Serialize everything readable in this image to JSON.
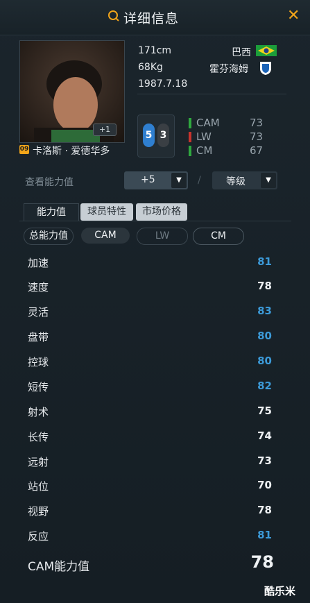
{
  "header": {
    "title": "详细信息",
    "close_symbol": "✕"
  },
  "player": {
    "name": "卡洛斯 · 爱德华多",
    "overall_badge": "09",
    "portrait_badge": "+1",
    "height": "171cm",
    "weight": "68Kg",
    "birth": "1987.7.18",
    "nationality": "巴西",
    "club": "霍芬海姆"
  },
  "feet": {
    "left": "5",
    "right": "3"
  },
  "positions": [
    {
      "pos": "CAM",
      "rating": "73",
      "color": "#2fa83f"
    },
    {
      "pos": "LW",
      "rating": "73",
      "color": "#c8342d"
    },
    {
      "pos": "CM",
      "rating": "67",
      "color": "#2fa83f"
    }
  ],
  "controls": {
    "view_label": "查看能力值",
    "level_value": "+5",
    "grade_label": "等级",
    "separator": "/"
  },
  "tabs": [
    "能力值",
    "球员特性",
    "市场价格"
  ],
  "pills": [
    "总能力值",
    "CAM",
    "LW",
    "CM"
  ],
  "stats": [
    {
      "name": "加速",
      "value": "81",
      "color": "#3c9ad8"
    },
    {
      "name": "速度",
      "value": "78",
      "color": "#eef1f3"
    },
    {
      "name": "灵活",
      "value": "83",
      "color": "#3c9ad8"
    },
    {
      "name": "盘带",
      "value": "80",
      "color": "#3c9ad8"
    },
    {
      "name": "控球",
      "value": "80",
      "color": "#3c9ad8"
    },
    {
      "name": "短传",
      "value": "82",
      "color": "#3c9ad8"
    },
    {
      "name": "射术",
      "value": "75",
      "color": "#eef1f3"
    },
    {
      "name": "长传",
      "value": "74",
      "color": "#eef1f3"
    },
    {
      "name": "远射",
      "value": "73",
      "color": "#eef1f3"
    },
    {
      "name": "站位",
      "value": "70",
      "color": "#eef1f3"
    },
    {
      "name": "视野",
      "value": "78",
      "color": "#eef1f3"
    },
    {
      "name": "反应",
      "value": "81",
      "color": "#3c9ad8"
    }
  ],
  "total": {
    "label": "CAM能力值",
    "value": "78"
  },
  "watermark": "酷乐米"
}
